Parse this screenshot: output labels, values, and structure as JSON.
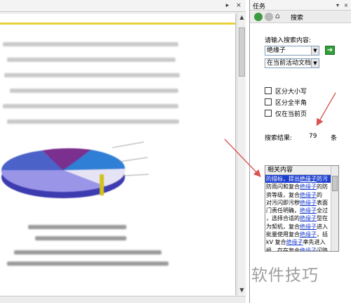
{
  "task_pane": {
    "title": "任务",
    "nav_title": "搜索",
    "search_label": "请输入搜索内容:",
    "search_value": "绝缘子",
    "scope_value": "在当前活动文档",
    "options": [
      {
        "label": "区分大小写",
        "checked": false
      },
      {
        "label": "区分全半角",
        "checked": false
      },
      {
        "label": "仅在当前页",
        "checked": false
      }
    ],
    "result_label": "搜索结果:",
    "result_count": "79",
    "result_unit": "条",
    "results_header": "相关内容",
    "results": [
      {
        "pre": "的描标，提出",
        "kw": "绝缘子",
        "post": "防污",
        "selected": true
      },
      {
        "pre": "防雨闪和复合",
        "kw": "绝缘子",
        "post": "的防",
        "selected": false
      },
      {
        "pre": "资等级，复合",
        "kw": "绝缘子",
        "post": "的",
        "selected": false
      },
      {
        "pre": "对污闪即污秽",
        "kw": "绝缘子",
        "post": "表面",
        "selected": false
      },
      {
        "pre": "门责任明确，",
        "kw": "绝缘子",
        "post": "全过",
        "selected": false
      },
      {
        "pre": "，选择合适的",
        "kw": "绝缘子",
        "post": "型在",
        "selected": false
      },
      {
        "pre": "为契机，复合",
        "kw": "绝缘子",
        "post": "进入",
        "selected": false
      },
      {
        "pre": "批量使用复合",
        "kw": "绝缘子",
        "post": "，括",
        "selected": false
      },
      {
        "pre": " kV 复合",
        "kw": "绝缘子",
        "post": "率先进入",
        "selected": false
      },
      {
        "pre": "损，存在复合",
        "kw": "绝缘子",
        "post": "闪路",
        "selected": false
      }
    ]
  },
  "watermark": "软件技巧",
  "colors": {
    "selection": "#1c3fd0",
    "link": "#1a3ccf",
    "go_button": "#2f9e36",
    "arrow": "#d9534f"
  },
  "icons": {
    "back": "back-icon",
    "forward": "forward-icon",
    "home": "home-icon",
    "go": "arrow-right-icon"
  }
}
